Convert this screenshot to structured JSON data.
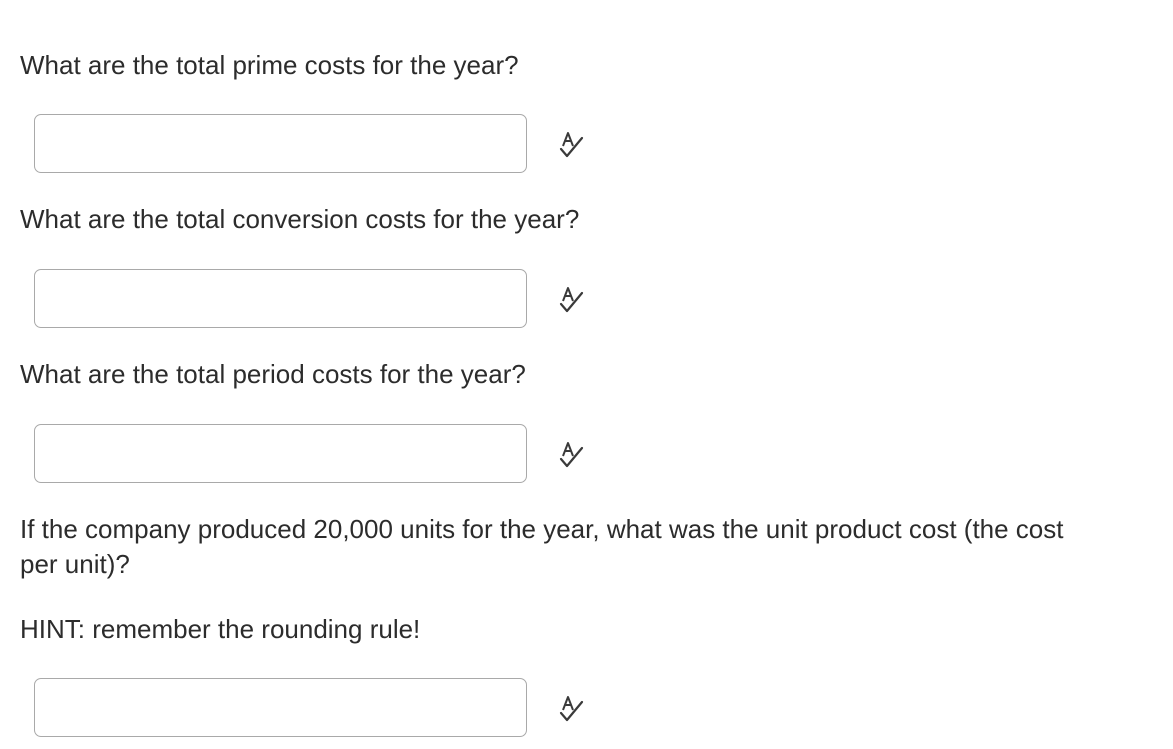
{
  "questions": [
    {
      "text": "What are the total prime costs for the year?",
      "answer_value": "",
      "icon": "spellcheck-icon"
    },
    {
      "text": "What are the total conversion costs for the year?",
      "answer_value": "",
      "icon": "spellcheck-icon"
    },
    {
      "text": "What are the total period costs for the year?",
      "answer_value": "",
      "icon": "spellcheck-icon"
    },
    {
      "text": "If the company produced 20,000 units for the year, what was the unit product cost (the cost per unit)?",
      "hint": "HINT: remember the rounding rule!",
      "answer_value": "",
      "icon": "spellcheck-icon"
    }
  ],
  "colors": {
    "text": "#2c2c2c",
    "input_border": "#a9a9a9",
    "icon": "#3a3a3a"
  }
}
